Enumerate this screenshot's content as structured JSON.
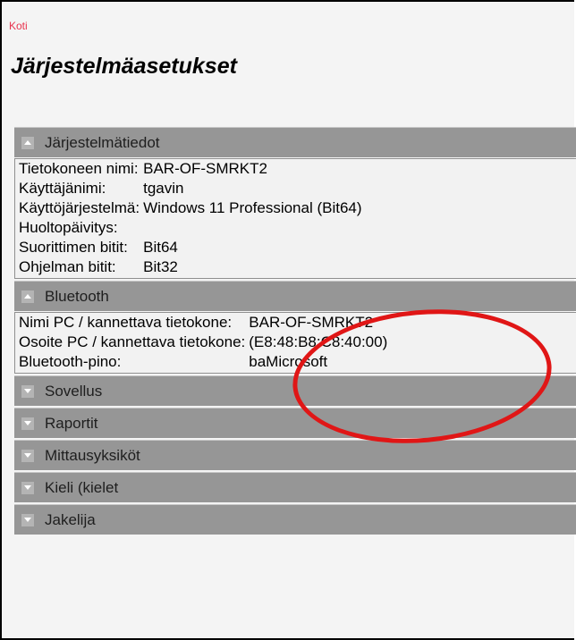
{
  "nav": {
    "home": "Koti"
  },
  "page": {
    "title": "Järjestelmäasetukset"
  },
  "system_info": {
    "header": "Järjestelmätiedot",
    "rows": [
      {
        "label": "Tietokoneen nimi:",
        "value": "BAR-OF-SMRKT2"
      },
      {
        "label": "Käyttäjänimi:",
        "value": "tgavin"
      },
      {
        "label": "Käyttöjärjestelmä:",
        "value": "Windows 11 Professional (Bit64)"
      },
      {
        "label": "Huoltopäivitys:",
        "value": ""
      },
      {
        "label": "Suorittimen bitit:",
        "value": "Bit64"
      },
      {
        "label": "Ohjelman bitit:",
        "value": "Bit32"
      }
    ]
  },
  "bluetooth": {
    "header": "Bluetooth",
    "rows": [
      {
        "label": "Nimi PC / kannettava tietokone:",
        "value": "BAR-OF-SMRKT2"
      },
      {
        "label": "Osoite PC / kannettava tietokone:",
        "value": "(E8:48:B8:C8:40:00)"
      },
      {
        "label": "Bluetooth-pino:",
        "value": "baMicrosoft"
      }
    ]
  },
  "collapsed_sections": [
    {
      "label": "Sovellus"
    },
    {
      "label": "Raportit"
    },
    {
      "label": "Mittausyksiköt"
    },
    {
      "label": "Kieli (kielet"
    },
    {
      "label": "Jakelija"
    }
  ],
  "colors": {
    "header_bg": "#969696",
    "link": "#e8334e",
    "annotation": "#e01616"
  }
}
